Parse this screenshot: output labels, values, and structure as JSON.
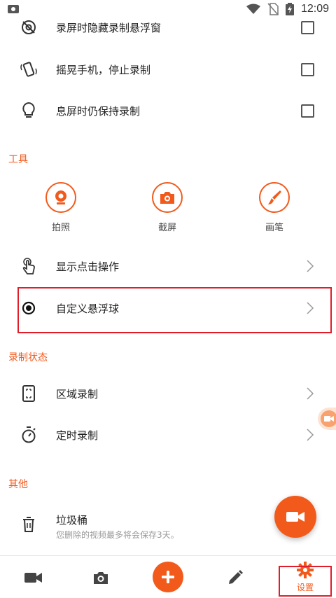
{
  "status_bar": {
    "time": "12:09"
  },
  "settings_rows_top": [
    {
      "label": "录屏时隐藏录制悬浮窗",
      "icon": "eye-off-icon",
      "checked": false
    },
    {
      "label": "摇晃手机，停止录制",
      "icon": "shake-phone-icon",
      "checked": false
    },
    {
      "label": "息屏时仍保持录制",
      "icon": "lightbulb-icon",
      "checked": false
    }
  ],
  "tools_section": {
    "title": "工具",
    "items": [
      {
        "label": "拍照",
        "icon": "webcam-icon"
      },
      {
        "label": "截屏",
        "icon": "camera-icon"
      },
      {
        "label": "画笔",
        "icon": "brush-icon"
      }
    ]
  },
  "nav_rows": [
    {
      "label": "显示点击操作",
      "icon": "touch-icon"
    },
    {
      "label": "自定义悬浮球",
      "icon": "radio-dot-icon"
    }
  ],
  "record_status_section": {
    "title": "录制状态",
    "items": [
      {
        "label": "区域录制",
        "icon": "area-record-icon"
      },
      {
        "label": "定时录制",
        "icon": "timer-icon"
      }
    ]
  },
  "other_section": {
    "title": "其他",
    "items": [
      {
        "label": "垃圾桶",
        "sublabel": "您删除的视频最多将会保存3天。",
        "icon": "trash-icon"
      }
    ]
  },
  "bottom_nav": {
    "items": [
      {
        "icon": "video-icon"
      },
      {
        "icon": "camera-icon"
      },
      {
        "icon": "plus-icon"
      },
      {
        "icon": "pencil-icon"
      },
      {
        "icon": "gear-icon",
        "label": "设置",
        "active": true
      }
    ]
  },
  "colors": {
    "accent": "#f25a1c",
    "highlight_border": "#e21d2a",
    "text": "#222222",
    "subtext": "#999999"
  }
}
